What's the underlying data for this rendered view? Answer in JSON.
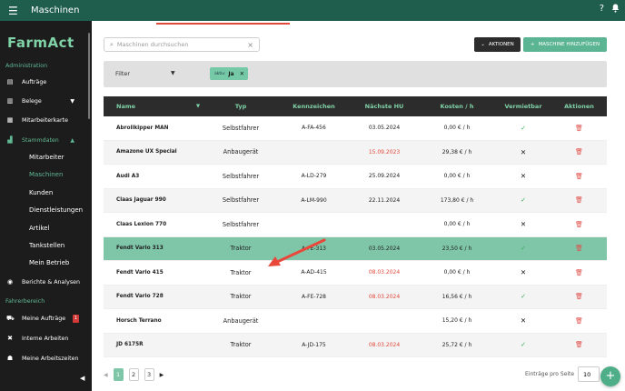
{
  "topbar": {
    "title": "Maschinen",
    "help_icon": "?",
    "bell_icon": "bell-icon"
  },
  "sidebar": {
    "logo": "FarmAct",
    "section_admin": "Administration",
    "items_admin": [
      {
        "label": "Aufträge",
        "icon": "orders-icon"
      },
      {
        "label": "Belege",
        "icon": "document-icon"
      },
      {
        "label": "Mitarbeiterkarte",
        "icon": "map-icon"
      },
      {
        "label": "Stammdaten",
        "icon": "data-icon"
      }
    ],
    "stammdaten_sub": [
      "Mitarbeiter",
      "Maschinen",
      "Kunden",
      "Dienstleistungen",
      "Artikel",
      "Tankstellen",
      "Mein Betrieb"
    ],
    "berichte": "Berichte & Analysen",
    "section_fahrer": "Fahrerbereich",
    "items_fahrer": [
      {
        "label": "Meine Aufträge",
        "badge": "1"
      },
      {
        "label": "Interne Arbeiten"
      },
      {
        "label": "Meine Arbeitszeiten"
      }
    ]
  },
  "toolbar": {
    "search_placeholder": "Maschinen durchsuchen",
    "aktionen_label": "AKTIONEN",
    "add_label": "MASCHINE HINZUFÜGEN"
  },
  "filter": {
    "label": "Filter",
    "chip_key": "aktiv:",
    "chip_value": "Ja"
  },
  "table": {
    "headers": [
      "Name",
      "Typ",
      "Kennzeichen",
      "Nächste HU",
      "Kosten / h",
      "Vermietbar",
      "Aktionen"
    ],
    "rows": [
      {
        "name": "Abrollkipper MAN",
        "typ": "Selbstfahrer",
        "kz": "A-FA-456",
        "hu": "03.05.2024",
        "hu_overdue": false,
        "kosten": "0,00 € / h",
        "vermietbar": true
      },
      {
        "name": "Amazone UX Special",
        "typ": "Anbaugerät",
        "kz": "",
        "hu": "15.09.2023",
        "hu_overdue": true,
        "kosten": "29,38 € / h",
        "vermietbar": false
      },
      {
        "name": "Audi A3",
        "typ": "Selbstfahrer",
        "kz": "A-LD-279",
        "hu": "25.09.2024",
        "hu_overdue": false,
        "kosten": "0,00 € / h",
        "vermietbar": false
      },
      {
        "name": "Claas Jaguar 990",
        "typ": "Selbstfahrer",
        "kz": "A-LM-990",
        "hu": "22.11.2024",
        "hu_overdue": false,
        "kosten": "173,80 € / h",
        "vermietbar": true
      },
      {
        "name": "Claas Lexion 770",
        "typ": "Selbstfahrer",
        "kz": "",
        "hu": "",
        "hu_overdue": false,
        "kosten": "0,00 € / h",
        "vermietbar": false
      },
      {
        "name": "Fendt Vario 313",
        "typ": "Traktor",
        "kz": "A-FE-313",
        "hu": "03.05.2024",
        "hu_overdue": false,
        "kosten": "23,50 € / h",
        "vermietbar": true
      },
      {
        "name": "Fendt Vario 415",
        "typ": "Traktor",
        "kz": "A-AD-415",
        "hu": "08.03.2024",
        "hu_overdue": true,
        "kosten": "0,00 € / h",
        "vermietbar": false
      },
      {
        "name": "Fendt Vario 728",
        "typ": "Traktor",
        "kz": "A-FE-728",
        "hu": "08.03.2024",
        "hu_overdue": true,
        "kosten": "16,56 € / h",
        "vermietbar": true
      },
      {
        "name": "Horsch Terrano",
        "typ": "Anbaugerät",
        "kz": "",
        "hu": "",
        "hu_overdue": false,
        "kosten": "15,20 € / h",
        "vermietbar": false
      },
      {
        "name": "JD 6175R",
        "typ": "Traktor",
        "kz": "A-JD-175",
        "hu": "08.03.2024",
        "hu_overdue": true,
        "kosten": "25,72 € / h",
        "vermietbar": true
      }
    ],
    "highlighted_row": 5
  },
  "pagination": {
    "pages": [
      "1",
      "2",
      "3"
    ],
    "current": "1",
    "per_page_label": "Einträge pro Seite",
    "per_page_value": "10"
  },
  "colors": {
    "brand": "#1f5d4d",
    "accent": "#5bb592",
    "highlight": "#7fc6a9",
    "danger": "#e04a3a"
  }
}
